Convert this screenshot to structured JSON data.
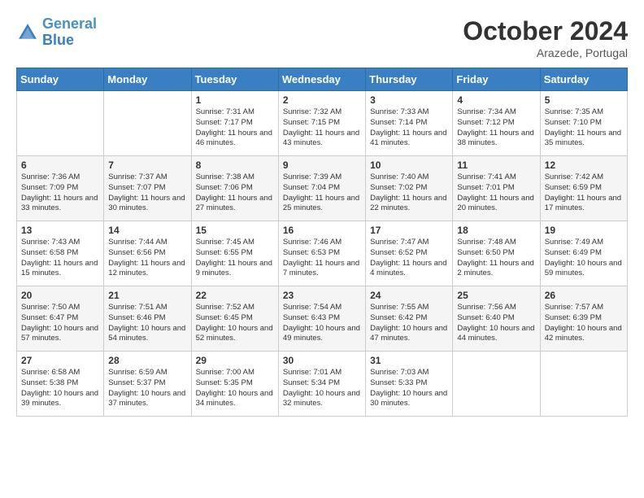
{
  "logo": {
    "line1": "General",
    "line2": "Blue"
  },
  "title": "October 2024",
  "subtitle": "Arazede, Portugal",
  "header": {
    "days": [
      "Sunday",
      "Monday",
      "Tuesday",
      "Wednesday",
      "Thursday",
      "Friday",
      "Saturday"
    ]
  },
  "weeks": [
    [
      {
        "day": "",
        "sunrise": "",
        "sunset": "",
        "daylight": ""
      },
      {
        "day": "",
        "sunrise": "",
        "sunset": "",
        "daylight": ""
      },
      {
        "day": "1",
        "sunrise": "Sunrise: 7:31 AM",
        "sunset": "Sunset: 7:17 PM",
        "daylight": "Daylight: 11 hours and 46 minutes."
      },
      {
        "day": "2",
        "sunrise": "Sunrise: 7:32 AM",
        "sunset": "Sunset: 7:15 PM",
        "daylight": "Daylight: 11 hours and 43 minutes."
      },
      {
        "day": "3",
        "sunrise": "Sunrise: 7:33 AM",
        "sunset": "Sunset: 7:14 PM",
        "daylight": "Daylight: 11 hours and 41 minutes."
      },
      {
        "day": "4",
        "sunrise": "Sunrise: 7:34 AM",
        "sunset": "Sunset: 7:12 PM",
        "daylight": "Daylight: 11 hours and 38 minutes."
      },
      {
        "day": "5",
        "sunrise": "Sunrise: 7:35 AM",
        "sunset": "Sunset: 7:10 PM",
        "daylight": "Daylight: 11 hours and 35 minutes."
      }
    ],
    [
      {
        "day": "6",
        "sunrise": "Sunrise: 7:36 AM",
        "sunset": "Sunset: 7:09 PM",
        "daylight": "Daylight: 11 hours and 33 minutes."
      },
      {
        "day": "7",
        "sunrise": "Sunrise: 7:37 AM",
        "sunset": "Sunset: 7:07 PM",
        "daylight": "Daylight: 11 hours and 30 minutes."
      },
      {
        "day": "8",
        "sunrise": "Sunrise: 7:38 AM",
        "sunset": "Sunset: 7:06 PM",
        "daylight": "Daylight: 11 hours and 27 minutes."
      },
      {
        "day": "9",
        "sunrise": "Sunrise: 7:39 AM",
        "sunset": "Sunset: 7:04 PM",
        "daylight": "Daylight: 11 hours and 25 minutes."
      },
      {
        "day": "10",
        "sunrise": "Sunrise: 7:40 AM",
        "sunset": "Sunset: 7:02 PM",
        "daylight": "Daylight: 11 hours and 22 minutes."
      },
      {
        "day": "11",
        "sunrise": "Sunrise: 7:41 AM",
        "sunset": "Sunset: 7:01 PM",
        "daylight": "Daylight: 11 hours and 20 minutes."
      },
      {
        "day": "12",
        "sunrise": "Sunrise: 7:42 AM",
        "sunset": "Sunset: 6:59 PM",
        "daylight": "Daylight: 11 hours and 17 minutes."
      }
    ],
    [
      {
        "day": "13",
        "sunrise": "Sunrise: 7:43 AM",
        "sunset": "Sunset: 6:58 PM",
        "daylight": "Daylight: 11 hours and 15 minutes."
      },
      {
        "day": "14",
        "sunrise": "Sunrise: 7:44 AM",
        "sunset": "Sunset: 6:56 PM",
        "daylight": "Daylight: 11 hours and 12 minutes."
      },
      {
        "day": "15",
        "sunrise": "Sunrise: 7:45 AM",
        "sunset": "Sunset: 6:55 PM",
        "daylight": "Daylight: 11 hours and 9 minutes."
      },
      {
        "day": "16",
        "sunrise": "Sunrise: 7:46 AM",
        "sunset": "Sunset: 6:53 PM",
        "daylight": "Daylight: 11 hours and 7 minutes."
      },
      {
        "day": "17",
        "sunrise": "Sunrise: 7:47 AM",
        "sunset": "Sunset: 6:52 PM",
        "daylight": "Daylight: 11 hours and 4 minutes."
      },
      {
        "day": "18",
        "sunrise": "Sunrise: 7:48 AM",
        "sunset": "Sunset: 6:50 PM",
        "daylight": "Daylight: 11 hours and 2 minutes."
      },
      {
        "day": "19",
        "sunrise": "Sunrise: 7:49 AM",
        "sunset": "Sunset: 6:49 PM",
        "daylight": "Daylight: 10 hours and 59 minutes."
      }
    ],
    [
      {
        "day": "20",
        "sunrise": "Sunrise: 7:50 AM",
        "sunset": "Sunset: 6:47 PM",
        "daylight": "Daylight: 10 hours and 57 minutes."
      },
      {
        "day": "21",
        "sunrise": "Sunrise: 7:51 AM",
        "sunset": "Sunset: 6:46 PM",
        "daylight": "Daylight: 10 hours and 54 minutes."
      },
      {
        "day": "22",
        "sunrise": "Sunrise: 7:52 AM",
        "sunset": "Sunset: 6:45 PM",
        "daylight": "Daylight: 10 hours and 52 minutes."
      },
      {
        "day": "23",
        "sunrise": "Sunrise: 7:54 AM",
        "sunset": "Sunset: 6:43 PM",
        "daylight": "Daylight: 10 hours and 49 minutes."
      },
      {
        "day": "24",
        "sunrise": "Sunrise: 7:55 AM",
        "sunset": "Sunset: 6:42 PM",
        "daylight": "Daylight: 10 hours and 47 minutes."
      },
      {
        "day": "25",
        "sunrise": "Sunrise: 7:56 AM",
        "sunset": "Sunset: 6:40 PM",
        "daylight": "Daylight: 10 hours and 44 minutes."
      },
      {
        "day": "26",
        "sunrise": "Sunrise: 7:57 AM",
        "sunset": "Sunset: 6:39 PM",
        "daylight": "Daylight: 10 hours and 42 minutes."
      }
    ],
    [
      {
        "day": "27",
        "sunrise": "Sunrise: 6:58 AM",
        "sunset": "Sunset: 5:38 PM",
        "daylight": "Daylight: 10 hours and 39 minutes."
      },
      {
        "day": "28",
        "sunrise": "Sunrise: 6:59 AM",
        "sunset": "Sunset: 5:37 PM",
        "daylight": "Daylight: 10 hours and 37 minutes."
      },
      {
        "day": "29",
        "sunrise": "Sunrise: 7:00 AM",
        "sunset": "Sunset: 5:35 PM",
        "daylight": "Daylight: 10 hours and 34 minutes."
      },
      {
        "day": "30",
        "sunrise": "Sunrise: 7:01 AM",
        "sunset": "Sunset: 5:34 PM",
        "daylight": "Daylight: 10 hours and 32 minutes."
      },
      {
        "day": "31",
        "sunrise": "Sunrise: 7:03 AM",
        "sunset": "Sunset: 5:33 PM",
        "daylight": "Daylight: 10 hours and 30 minutes."
      },
      {
        "day": "",
        "sunrise": "",
        "sunset": "",
        "daylight": ""
      },
      {
        "day": "",
        "sunrise": "",
        "sunset": "",
        "daylight": ""
      }
    ]
  ]
}
